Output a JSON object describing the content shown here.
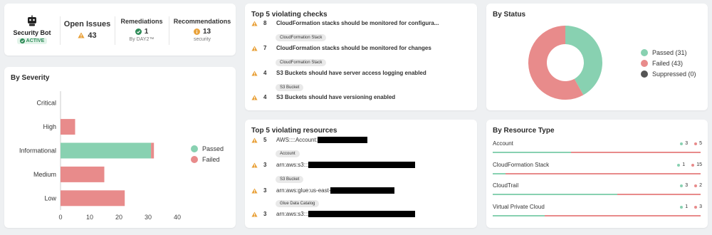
{
  "colors": {
    "passed": "#88d1b1",
    "failed": "#e88b8b",
    "suppressed": "#555555",
    "warning": "#e9a23b",
    "active": "#2e8b57"
  },
  "summary": {
    "bot": {
      "name": "Security Bot",
      "status": "ACTIVE",
      "icon": "robot-icon"
    },
    "open_issues": {
      "title": "Open Issues",
      "value": "43",
      "icon": "warning-icon"
    },
    "remediations": {
      "title": "Remediations",
      "value": "1",
      "sub": "By DAY2™",
      "icon": "check-circle-icon"
    },
    "recommendations": {
      "title": "Recommendations",
      "value": "13",
      "sub": "security",
      "icon": "info-circle-icon"
    }
  },
  "severity": {
    "title": "By Severity",
    "legend": {
      "passed": "Passed",
      "failed": "Failed"
    }
  },
  "chart_data": {
    "type": "bar",
    "orientation": "horizontal",
    "stacked": true,
    "categories": [
      "Critical",
      "High",
      "Informational",
      "Medium",
      "Low"
    ],
    "series": [
      {
        "name": "Passed",
        "values": [
          0,
          0,
          31,
          0,
          0
        ]
      },
      {
        "name": "Failed",
        "values": [
          0,
          5,
          1,
          15,
          22
        ]
      }
    ],
    "xlim": [
      0,
      40
    ],
    "xticks": [
      "0",
      "10",
      "20",
      "30",
      "40"
    ]
  },
  "checks": {
    "title": "Top 5 violating checks",
    "items": [
      {
        "count": "8",
        "text": "CloudFormation stacks should be monitored for configura...",
        "tag": "CloudFormation Stack"
      },
      {
        "count": "7",
        "text": "CloudFormation stacks should be monitored for changes",
        "tag": "CloudFormation Stack"
      },
      {
        "count": "4",
        "text": "S3 Buckets should have server access logging enabled",
        "tag": "S3 Bucket"
      },
      {
        "count": "4",
        "text": "S3 Buckets should have versioning enabled",
        "tag": ""
      }
    ]
  },
  "resources": {
    "title": "Top 5 violating resources",
    "items": [
      {
        "count": "5",
        "text": "AWS::::Account:",
        "tag": "Account"
      },
      {
        "count": "3",
        "text": "arn:aws:s3:::",
        "tag": "S3 Bucket"
      },
      {
        "count": "3",
        "text": "arn:aws:glue:us-east-",
        "tag": "Glue Data Catalog"
      },
      {
        "count": "3",
        "text": "arn:aws:s3:::",
        "tag": ""
      }
    ]
  },
  "status": {
    "title": "By Status",
    "passed": 31,
    "failed": 43,
    "suppressed": 0,
    "legend": [
      "Passed (31)",
      "Failed (43)",
      "Suppressed (0)"
    ]
  },
  "resource_type": {
    "title": "By Resource Type",
    "items": [
      {
        "name": "Account",
        "passed": 3,
        "failed": 5,
        "passed_label": "3",
        "failed_label": "5"
      },
      {
        "name": "CloudFormation Stack",
        "passed": 1,
        "failed": 15,
        "passed_label": "1",
        "failed_label": "15"
      },
      {
        "name": "CloudTrail",
        "passed": 3,
        "failed": 2,
        "passed_label": "3",
        "failed_label": "2"
      },
      {
        "name": "Virtual Private Cloud",
        "passed": 1,
        "failed": 3,
        "passed_label": "1",
        "failed_label": "3"
      }
    ]
  }
}
